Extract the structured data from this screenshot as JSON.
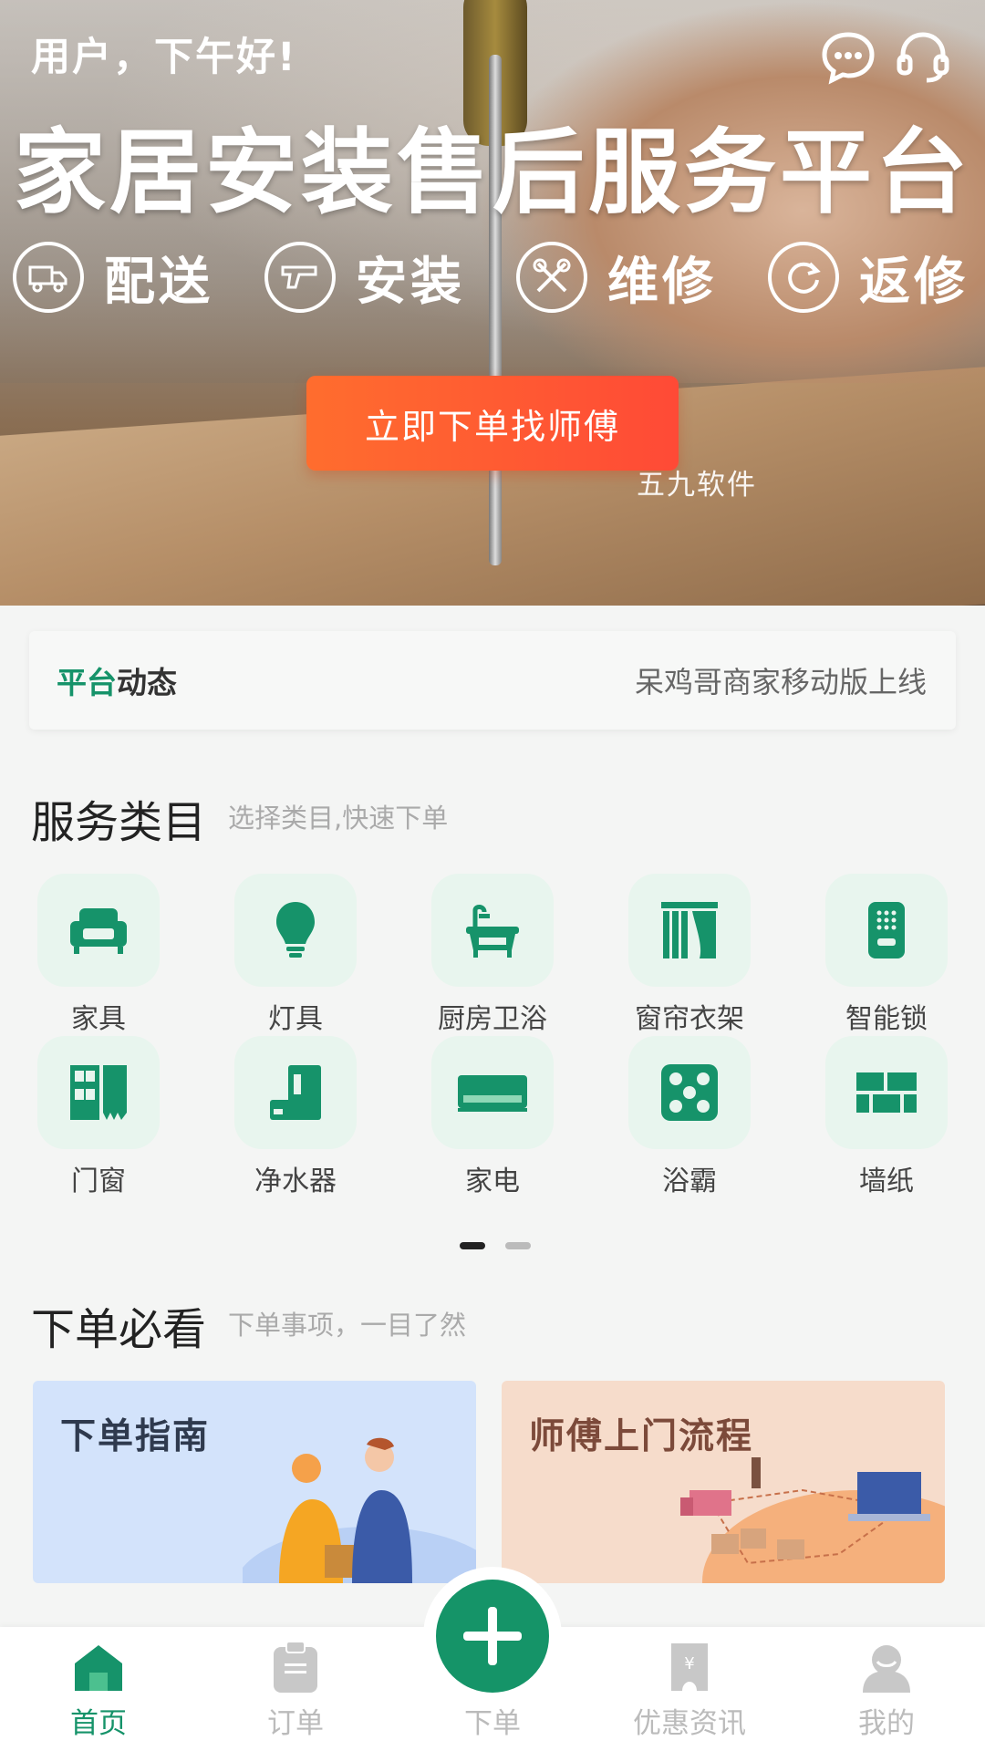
{
  "header": {
    "greeting": "用户，下午好!",
    "title": "家居安装售后服务平台",
    "icons": [
      "chat-icon",
      "headset-icon"
    ]
  },
  "features": [
    {
      "label": "配送",
      "icon": "truck-icon"
    },
    {
      "label": "安装",
      "icon": "drill-icon"
    },
    {
      "label": "维修",
      "icon": "tools-icon"
    },
    {
      "label": "返修",
      "icon": "refresh-icon"
    }
  ],
  "order_button": "立即下单找师傅",
  "watermark": "五九软件",
  "news": {
    "tag_green": "平台",
    "tag_dark": "动态",
    "ticker": "呆鸡哥商家移动版上线"
  },
  "services": {
    "title": "服务类目",
    "subtitle": "选择类目,快速下单",
    "items": [
      {
        "name": "家具",
        "icon": "sofa-icon"
      },
      {
        "name": "灯具",
        "icon": "bulb-icon"
      },
      {
        "name": "厨房卫浴",
        "icon": "bathtub-icon"
      },
      {
        "name": "窗帘衣架",
        "icon": "curtain-icon"
      },
      {
        "name": "智能锁",
        "icon": "smart-lock-icon"
      },
      {
        "name": "门窗",
        "icon": "door-window-icon"
      },
      {
        "name": "净水器",
        "icon": "water-purifier-icon"
      },
      {
        "name": "家电",
        "icon": "air-conditioner-icon"
      },
      {
        "name": "浴霸",
        "icon": "bath-heater-icon"
      },
      {
        "name": "墙纸",
        "icon": "wallpaper-icon"
      }
    ],
    "pages": 2,
    "active_page": 1
  },
  "guide": {
    "title": "下单必看",
    "subtitle": "下单事项，一目了然",
    "cards": [
      {
        "title": "下单指南"
      },
      {
        "title": "师傅上门流程"
      }
    ]
  },
  "bottom_nav": [
    {
      "label": "首页",
      "icon": "home-icon",
      "active": true
    },
    {
      "label": "订单",
      "icon": "clipboard-icon",
      "active": false
    },
    {
      "label": "下单",
      "icon": "plus-icon",
      "active": false
    },
    {
      "label": "优惠资讯",
      "icon": "coupon-icon",
      "active": false
    },
    {
      "label": "我的",
      "icon": "user-icon",
      "active": false
    }
  ],
  "colors": {
    "brand_green": "#16936a",
    "tile_bg": "#e8f5ee",
    "button_orange": "#ff5a30"
  }
}
